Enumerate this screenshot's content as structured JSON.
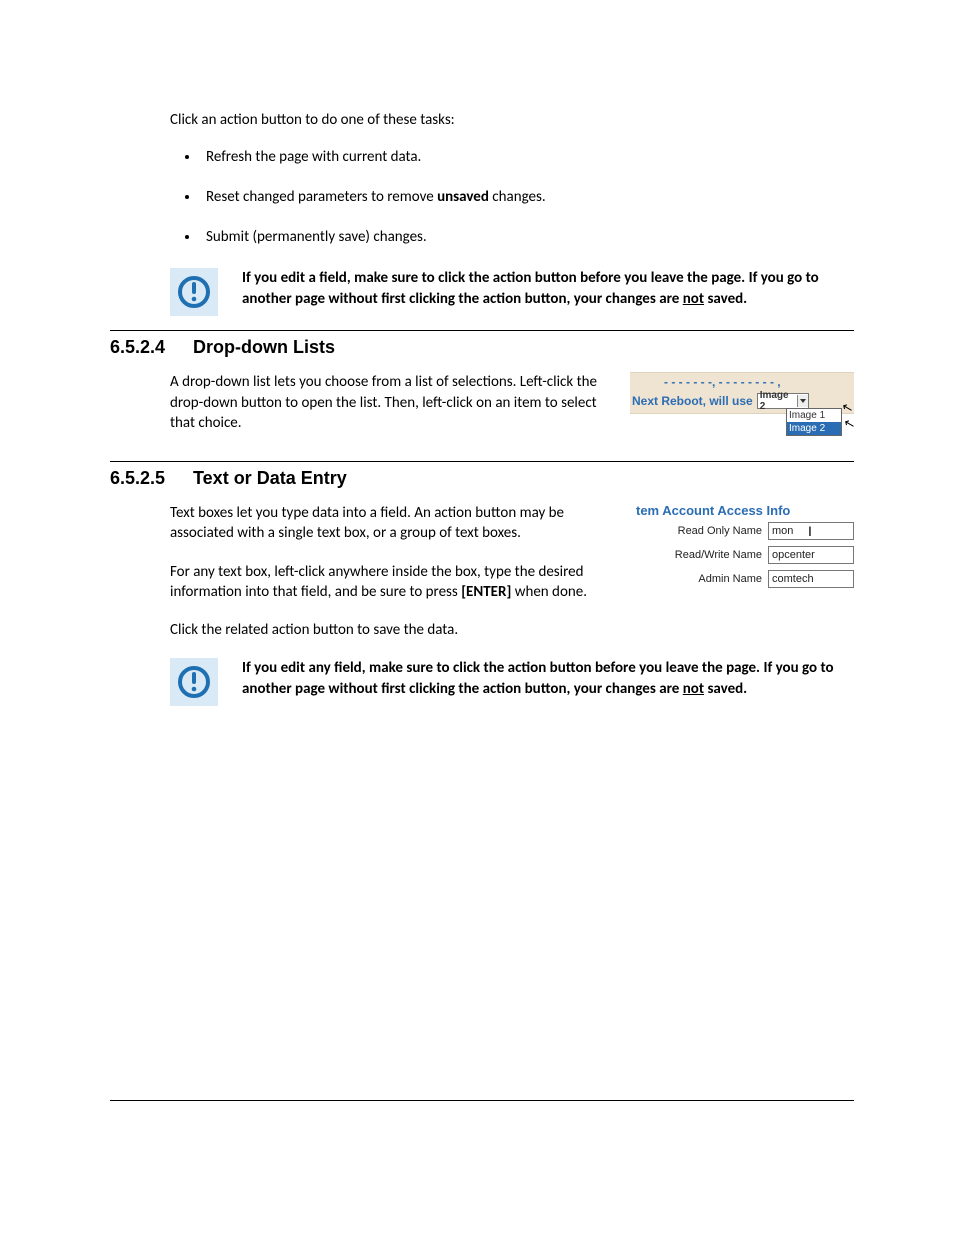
{
  "intro": "Click an action button to do one of these tasks:",
  "bullets": {
    "b1": "Refresh the page with current data.",
    "b2_pre": "Reset changed parameters to remove ",
    "b2_bold": "unsaved",
    "b2_post": " changes.",
    "b3": "Submit (permanently save) changes."
  },
  "note1": {
    "pre": "If you edit a field, make sure to click the action button before you leave the page. If you go to another page without first clicking the action button, your changes are ",
    "not": "not",
    "post": " saved."
  },
  "sec4": {
    "num": "6.5.2.4",
    "title": "Drop-down Lists",
    "body": "A drop-down list lets you choose from a list of selections. Left-click the drop-down button to open the list. Then, left-click on an item to select that choice.",
    "illus": {
      "clipped_top": "- - - - - - -, - - - - - - - - ,",
      "line2": "Next Reboot, will use",
      "selected": "Image 2",
      "opt1": "Image 1",
      "opt2": "Image 2"
    }
  },
  "sec5": {
    "num": "6.5.2.5",
    "title": "Text or Data Entry",
    "p1": "Text boxes let you type data into a field. An action button may be associated with a single text box, or a group of text boxes.",
    "p2_pre": "For any text box, left-click anywhere inside the box, type the desired information into that field, and be sure to press ",
    "p2_bold": "[ENTER]",
    "p2_post": " when done.",
    "p3": "Click the related action button to save the data.",
    "illus": {
      "title": "tem Account Access Info",
      "r1label": "Read Only Name",
      "r1val": "mon",
      "r2label": "Read/Write Name",
      "r2val": "opcenter",
      "r3label": "Admin Name",
      "r3val": "comtech"
    }
  },
  "note2": {
    "pre": "If you edit any field, make sure to click the action button before you leave the page. If you go to another page without first clicking the action button, your changes are ",
    "not": "not",
    "post": " saved."
  }
}
